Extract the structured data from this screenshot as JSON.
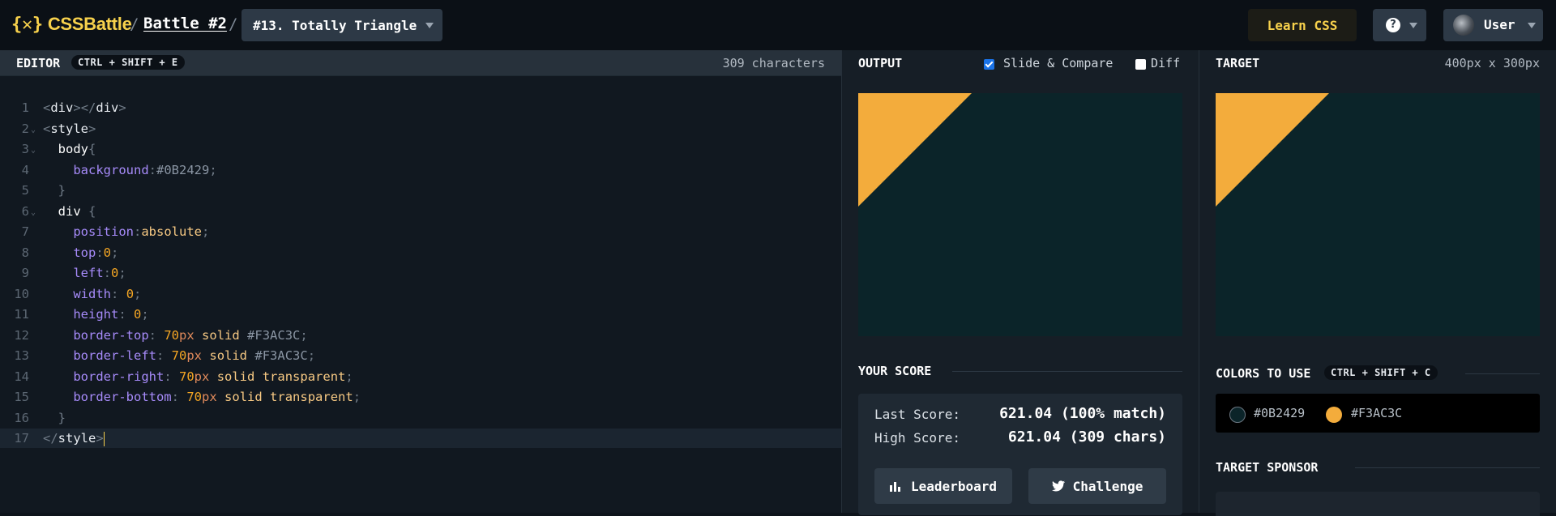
{
  "header": {
    "logo_text": "CSSBattle",
    "logo_mark": "{ጰ}",
    "breadcrumb_sep": "/",
    "battle": "Battle #2",
    "level": "#13. Totally Triangle",
    "learn_css": "Learn CSS",
    "help_icon": "?",
    "user": "User"
  },
  "editor": {
    "label": "EDITOR",
    "shortcut": "CTRL + SHIFT + E",
    "char_count": "309 characters",
    "active_line": 17,
    "lines": [
      {
        "n": "1",
        "text": "<div></div>"
      },
      {
        "n": "2",
        "text": "<style>"
      },
      {
        "n": "3",
        "text": "  body{"
      },
      {
        "n": "4",
        "text": "    background:#0B2429;"
      },
      {
        "n": "5",
        "text": "  }"
      },
      {
        "n": "6",
        "text": "  div {"
      },
      {
        "n": "7",
        "text": "    position:absolute;"
      },
      {
        "n": "8",
        "text": "    top:0;"
      },
      {
        "n": "9",
        "text": "    left:0;"
      },
      {
        "n": "10",
        "text": "    width: 0;"
      },
      {
        "n": "11",
        "text": "    height: 0;"
      },
      {
        "n": "12",
        "text": "    border-top: 70px solid #F3AC3C;"
      },
      {
        "n": "13",
        "text": "    border-left: 70px solid #F3AC3C;"
      },
      {
        "n": "14",
        "text": "    border-right: 70px solid transparent;"
      },
      {
        "n": "15",
        "text": "    border-bottom: 70px solid transparent;"
      },
      {
        "n": "16",
        "text": "  }"
      },
      {
        "n": "17",
        "text": "</style>"
      }
    ]
  },
  "output": {
    "label": "OUTPUT",
    "slide_compare": "Slide & Compare",
    "slide_compare_checked": true,
    "diff": "Diff",
    "diff_checked": false
  },
  "score": {
    "title": "YOUR SCORE",
    "last_label": "Last Score:",
    "last_value": "621.04 (100% match)",
    "high_label": "High Score:",
    "high_value": "621.04 (309 chars)",
    "leaderboard": "Leaderboard",
    "challenge": "Challenge"
  },
  "target": {
    "label": "TARGET",
    "size": "400px x 300px",
    "colors_title": "COLORS TO USE",
    "colors_shortcut": "CTRL + SHIFT + C",
    "colors": [
      {
        "hex": "#0B2429",
        "label": "#0B2429"
      },
      {
        "hex": "#F3AC3C",
        "label": "#F3AC3C"
      }
    ],
    "sponsor_title": "TARGET SPONSOR"
  },
  "theme": {
    "accent": "#F7D14C",
    "bg": "#0B2429",
    "shape": "#F3AC3C"
  }
}
